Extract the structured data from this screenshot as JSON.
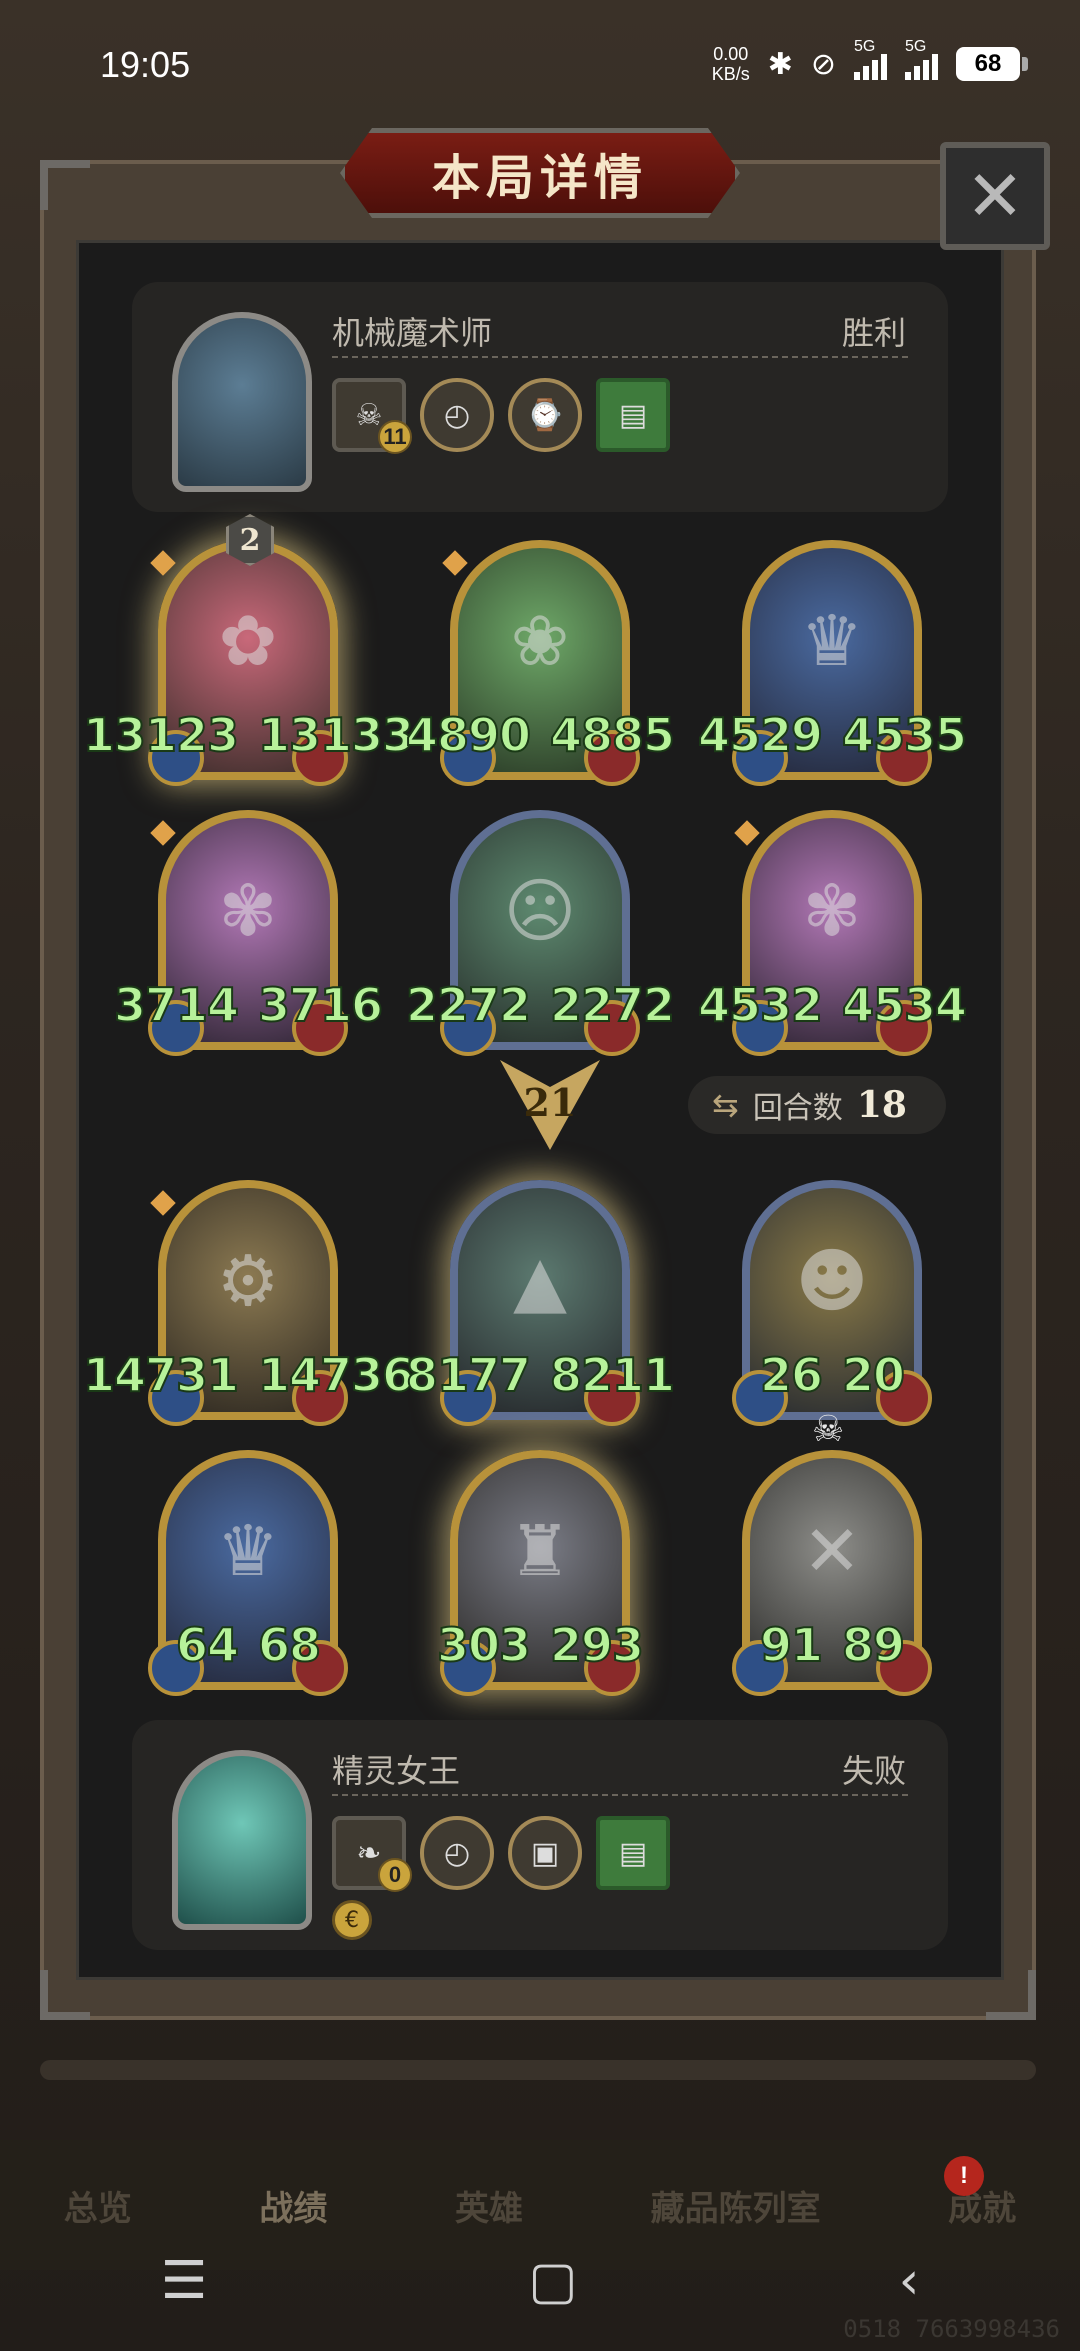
{
  "status_bar": {
    "time": "19:05",
    "net_speed_value": "0.00",
    "net_speed_unit": "KB/s",
    "network_1": "5G",
    "network_2": "5G",
    "battery": "68"
  },
  "dialog": {
    "title": "本局详情",
    "close_icon": "close-icon"
  },
  "player_top": {
    "name": "机械魔术师",
    "result": "胜利",
    "item_level": "11"
  },
  "player_bottom": {
    "name": "精灵女王",
    "result": "失败",
    "item_level": "0"
  },
  "top_board": {
    "units": [
      {
        "atk": "13123",
        "hp": "13133",
        "tier": "2"
      },
      {
        "atk": "4890",
        "hp": "4885"
      },
      {
        "atk": "4529",
        "hp": "4535"
      },
      {
        "atk": "3714",
        "hp": "3716"
      },
      {
        "atk": "2272",
        "hp": "2272"
      },
      {
        "atk": "4532",
        "hp": "4534"
      }
    ]
  },
  "turn_marker": "21",
  "round": {
    "label": "回合数",
    "count": "18"
  },
  "bottom_board": {
    "units": [
      {
        "atk": "14731",
        "hp": "14736"
      },
      {
        "atk": "8177",
        "hp": "8211"
      },
      {
        "atk": "26",
        "hp": "20"
      },
      {
        "atk": "64",
        "hp": "68"
      },
      {
        "atk": "303",
        "hp": "293"
      },
      {
        "atk": "91",
        "hp": "89"
      }
    ]
  },
  "nav": {
    "tabs": [
      "总览",
      "战绩",
      "英雄",
      "藏品陈列室",
      "成就"
    ],
    "active": "战绩",
    "badge": "!"
  },
  "watermark": "0518 7663998436"
}
